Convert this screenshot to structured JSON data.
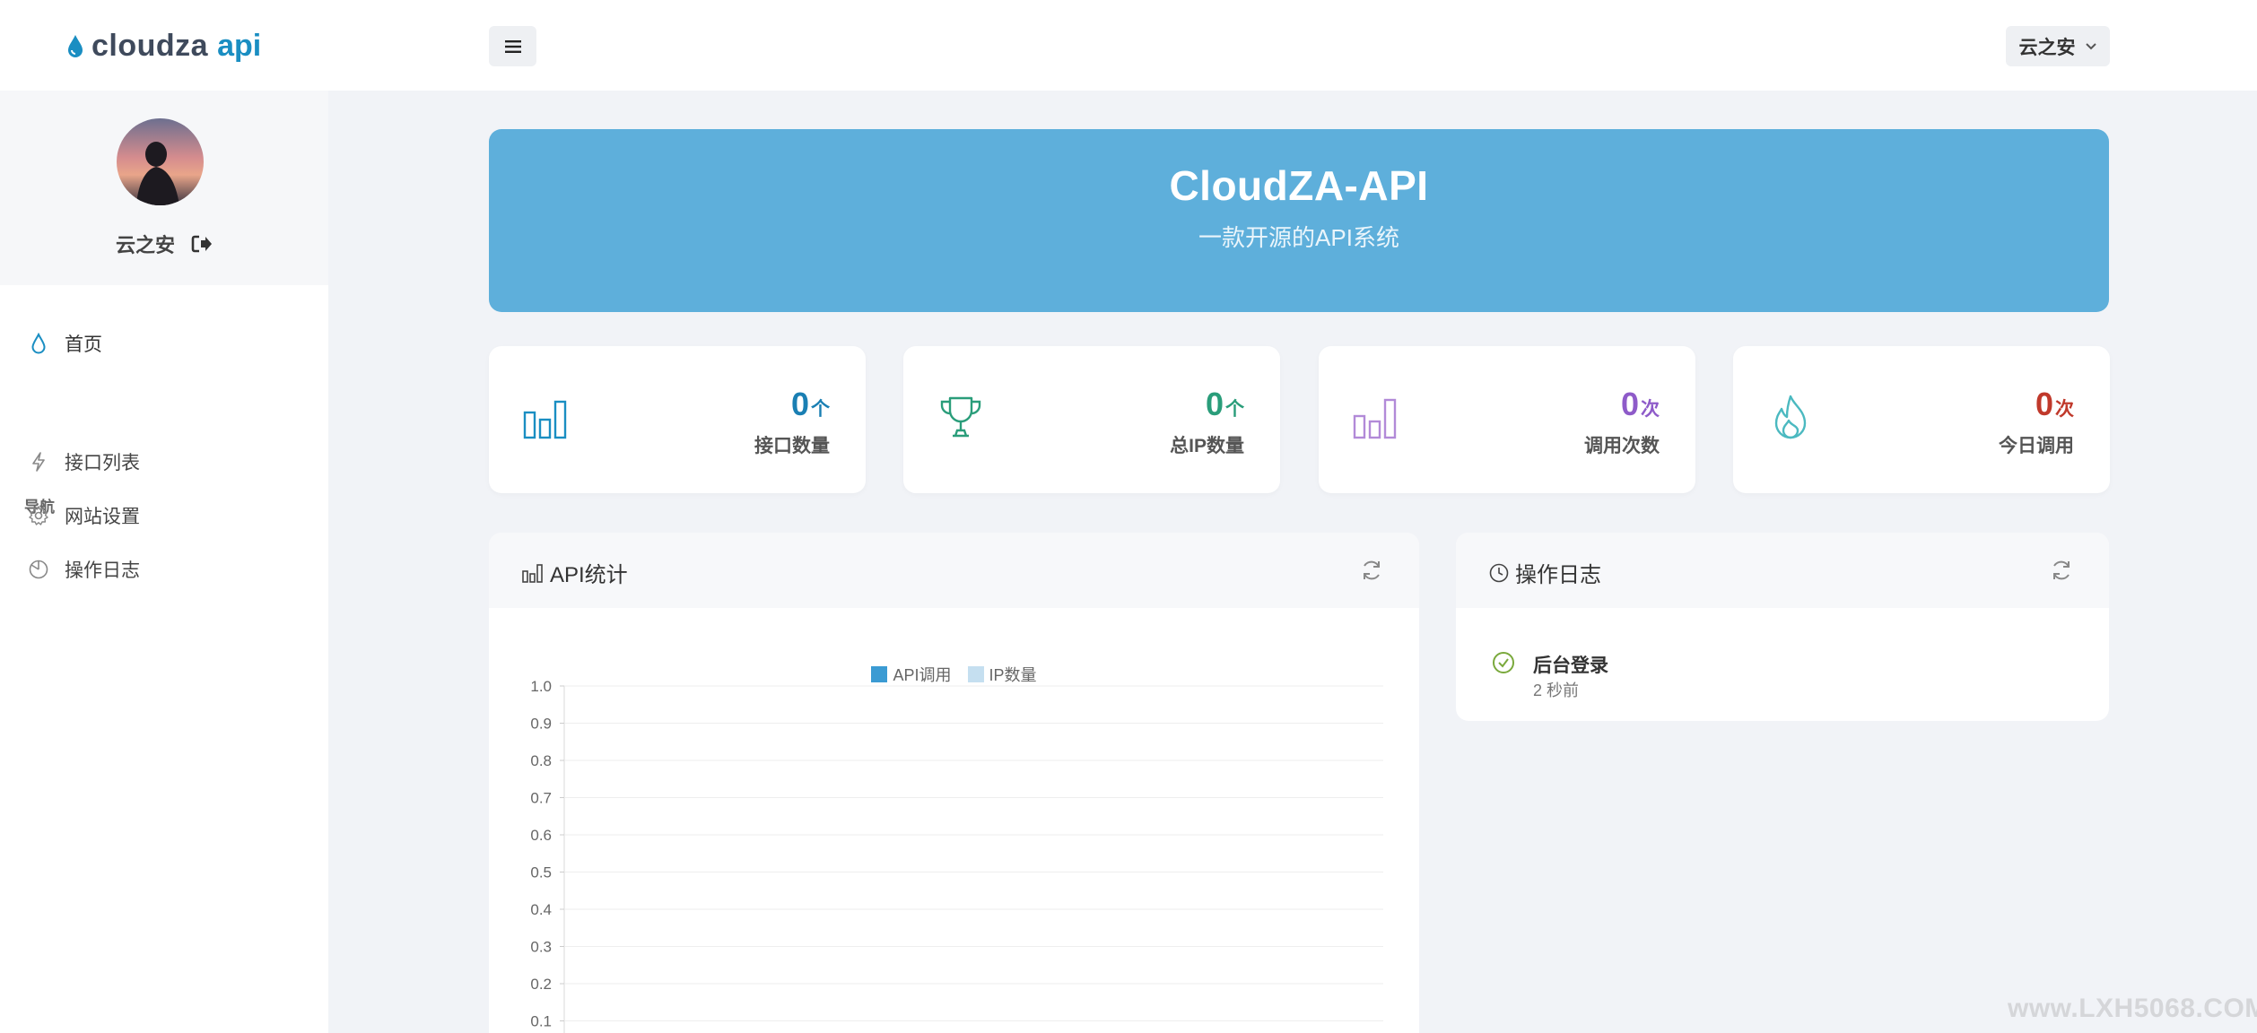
{
  "brand": {
    "part1": "cloudza",
    "part2": "api",
    "accent": "#1a8ec2"
  },
  "topbar": {
    "menu_icon": "menu-icon",
    "user_label": "云之安"
  },
  "sidebar": {
    "username": "云之安",
    "logout_icon": "logout-icon",
    "home": "首页",
    "section_label": "导航",
    "items": [
      {
        "label": "接口列表",
        "icon": "lightning-icon"
      },
      {
        "label": "网站设置",
        "icon": "gear-icon"
      },
      {
        "label": "操作日志",
        "icon": "pie-icon"
      }
    ]
  },
  "banner": {
    "title": "CloudZA-API",
    "subtitle": "一款开源的API系统",
    "color": "#5eafdb"
  },
  "stats": [
    {
      "value": "0",
      "unit": "个",
      "label": "接口数量",
      "color": "#1a7fb3"
    },
    {
      "value": "0",
      "unit": "个",
      "label": "总IP数量",
      "color": "#2a9d7a"
    },
    {
      "value": "0",
      "unit": "次",
      "label": "调用次数",
      "color": "#8e5bc9"
    },
    {
      "value": "0",
      "unit": "次",
      "label": "今日调用",
      "color": "#c0392b"
    }
  ],
  "api_panel": {
    "title": "API统计"
  },
  "log_panel": {
    "title": "操作日志",
    "entries": [
      {
        "title": "后台登录",
        "time": "2 秒前"
      }
    ]
  },
  "chart_data": {
    "type": "bar",
    "series": [
      {
        "name": "API调用",
        "values": [],
        "color": "#3b9bd3"
      },
      {
        "name": "IP数量",
        "values": [],
        "color": "#c5dff0"
      }
    ],
    "categories": [],
    "ylim": [
      0,
      1.0
    ],
    "yticks": [
      "0.1",
      "0.2",
      "0.3",
      "0.4",
      "0.5",
      "0.6",
      "0.7",
      "0.8",
      "0.9",
      "1.0"
    ],
    "grid": true,
    "legend": "top-center"
  },
  "watermark": "www.LXH5068.COM"
}
